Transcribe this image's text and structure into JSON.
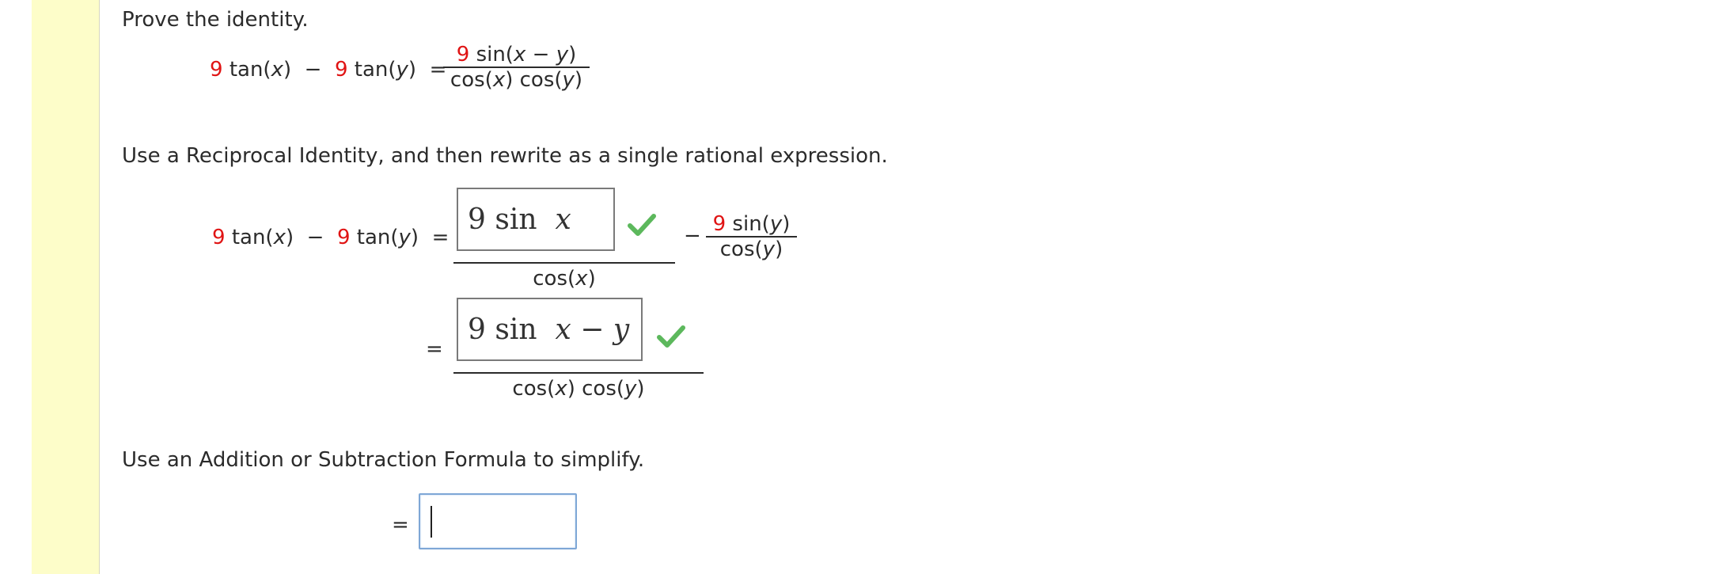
{
  "prompt": "Prove the identity.",
  "identity": {
    "coef1": "9",
    "tan_x": "tan(",
    "x": "x",
    "close": ")",
    "minus": "−",
    "coef2": "9",
    "tan_y": "tan(",
    "y": "y",
    "equals": "=",
    "num_coef": "9",
    "num_rest_a": "sin(",
    "num_x": "x",
    "num_minus": " − ",
    "num_y": "y",
    "num_close": ")",
    "den_a": "cos(",
    "den_x": "x",
    "den_b": ") cos(",
    "den_y": "y",
    "den_c": ")"
  },
  "step1": {
    "instruction": "Use a Reciprocal Identity, and then rewrite as a single rational expression.",
    "answer1": {
      "coef": "9",
      "func": "sin",
      "var": "x"
    },
    "answer1_den_a": "cos(",
    "answer1_den_x": "x",
    "answer1_den_b": ")",
    "minus": "−",
    "frac2_num_coef": "9",
    "frac2_num_a": "sin(",
    "frac2_num_y": "y",
    "frac2_num_b": ")",
    "frac2_den_a": "cos(",
    "frac2_den_y": "y",
    "frac2_den_b": ")",
    "equals2": "=",
    "answer2": {
      "coef": "9",
      "func": "sin",
      "var1": "x",
      "op": "−",
      "var2": "y"
    },
    "answer2_den_a": "cos(",
    "answer2_den_x": "x",
    "answer2_den_b": ") cos(",
    "answer2_den_y": "y",
    "answer2_den_c": ")"
  },
  "step2": {
    "instruction": "Use an Addition or Subtraction Formula to simplify.",
    "equals": "=",
    "input_value": ""
  },
  "colors": {
    "red": "#e01414",
    "check": "#5cb85c",
    "gutter": "#fdfdc9",
    "input_border": "#7ea7d6"
  }
}
